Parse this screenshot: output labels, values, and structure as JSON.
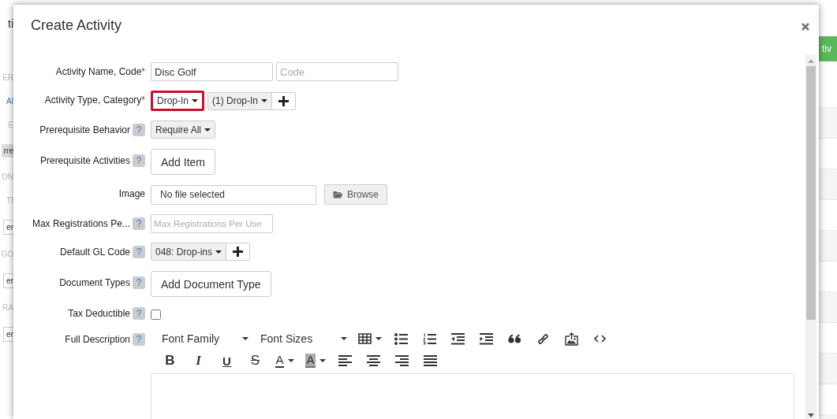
{
  "background": {
    "title_fragment": "ti",
    "sidebar_fragments": [
      {
        "kind": "heading",
        "text": "ER"
      },
      {
        "kind": "link",
        "text": "Al"
      },
      {
        "kind": "heading",
        "text": "E"
      },
      {
        "kind": "button",
        "text": "rre"
      },
      {
        "kind": "heading",
        "text": "ON"
      },
      {
        "kind": "heading",
        "text": "TI"
      },
      {
        "kind": "select",
        "text": "er"
      },
      {
        "kind": "heading",
        "text": "GO"
      },
      {
        "kind": "select",
        "text": "er"
      },
      {
        "kind": "heading",
        "text": "RA"
      },
      {
        "kind": "select",
        "text": "er"
      }
    ],
    "action_fragment": "tiv"
  },
  "modal": {
    "title": "Create Activity",
    "fields": [
      {
        "kind": "name_code",
        "label": "Activity Name, Code",
        "required_mark": "*",
        "value": "Disc Golf",
        "code_placeholder": "Code"
      },
      {
        "kind": "type_category",
        "label": "Activity Type, Category",
        "required_mark": "*",
        "type": "Drop-In",
        "highlighted": true,
        "category": "(1) Drop-In"
      },
      {
        "kind": "select",
        "label": "Prerequisite Behavior",
        "help": "?",
        "value": "Require All"
      },
      {
        "kind": "button",
        "label": "Prerequisite Activities",
        "help": "?",
        "button": "Add Item"
      },
      {
        "kind": "file",
        "label": "Image",
        "file": "No file selected",
        "browse": "Browse"
      },
      {
        "kind": "input",
        "label": "Max Registrations Pe...",
        "help": "?",
        "placeholder": "Max Registrations Per Use"
      },
      {
        "kind": "select_add",
        "label": "Default GL Code",
        "help": "?",
        "value": "048: Drop-ins"
      },
      {
        "kind": "button",
        "label": "Document Types",
        "help": "?",
        "button": "Add Document Type"
      },
      {
        "kind": "checkbox",
        "label": "Tax Deductible",
        "help": "?",
        "checked": false
      },
      {
        "kind": "editor",
        "label": "Full Description",
        "help": "?",
        "font_family": "Font Family",
        "font_sizes": "Font Sizes",
        "format": [
          {
            "kind": "bold",
            "label": "B"
          },
          {
            "kind": "italic",
            "label": "I"
          },
          {
            "kind": "underline",
            "label": "U"
          },
          {
            "kind": "strike",
            "label": "S"
          },
          {
            "kind": "color",
            "label": "A"
          },
          {
            "kind": "highlight",
            "label": "A"
          }
        ]
      }
    ]
  }
}
